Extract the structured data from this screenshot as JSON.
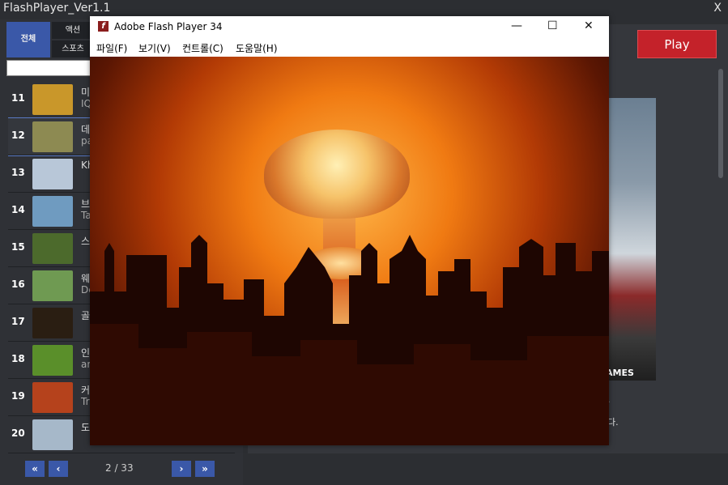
{
  "app": {
    "title": "FlashPlayer_Ver1.1",
    "close": "X"
  },
  "categories": {
    "all": "전체",
    "action": "액션",
    "sports": "스포츠"
  },
  "search": {
    "value": "",
    "placeholder": ""
  },
  "games": [
    {
      "num": "11",
      "name": "미",
      "sub": "IQ",
      "thumb_color": "#c9972a"
    },
    {
      "num": "12",
      "name": "데",
      "sub": "pa",
      "thumb_color": "#8d8a52",
      "selected": true
    },
    {
      "num": "13",
      "name": "Kh",
      "sub": "",
      "thumb_color": "#b8c7d8"
    },
    {
      "num": "14",
      "name": "브",
      "sub": "Ta",
      "thumb_color": "#6f9bc0"
    },
    {
      "num": "15",
      "name": "스",
      "sub": "",
      "thumb_color": "#4c6a2c"
    },
    {
      "num": "16",
      "name": "웨",
      "sub": "De",
      "thumb_color": "#6f9a52"
    },
    {
      "num": "17",
      "name": "골",
      "sub": "",
      "thumb_color": "#2a1e12"
    },
    {
      "num": "18",
      "name": "인",
      "sub": "ar",
      "thumb_color": "#5a8f2a"
    },
    {
      "num": "19",
      "name": "커",
      "sub": "Tr",
      "thumb_color": "#b5421c"
    },
    {
      "num": "20",
      "name": "도",
      "sub": "",
      "thumb_color": "#a6b8c9"
    }
  ],
  "pager": {
    "first": "«",
    "prev": "‹",
    "text": "2 / 33",
    "next": "›",
    "last": "»"
  },
  "play": {
    "label": "Play"
  },
  "preview": {
    "label": "AMES",
    "desc1": ".",
    "desc2": "다."
  },
  "flash_window": {
    "title": "Adobe Flash Player 34",
    "logo": "f",
    "minimize": "—",
    "maximize": "☐",
    "close": "✕",
    "menus": [
      "파일(F)",
      "보기(V)",
      "컨트롤(C)",
      "도움말(H)"
    ]
  },
  "colors": {
    "accent": "#3a58a8",
    "play": "#c4222a",
    "bg": "#2c2e32"
  }
}
